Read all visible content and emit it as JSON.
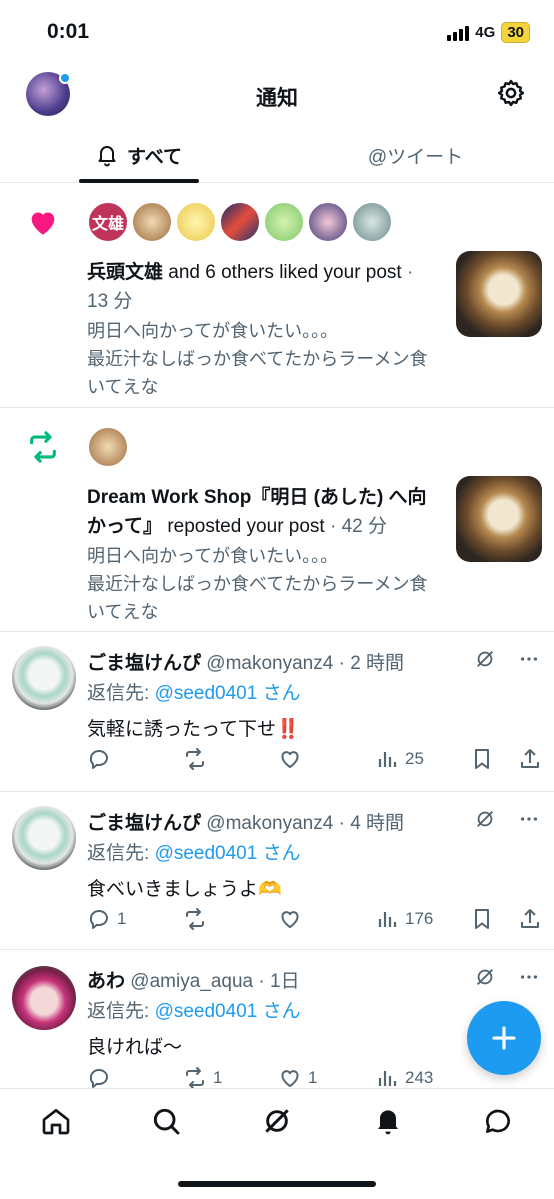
{
  "status_bar": {
    "time": "0:01",
    "network": "4G",
    "battery": "30"
  },
  "header": {
    "title": "通知"
  },
  "tabs": [
    {
      "label": "すべて"
    },
    {
      "label": "@ツイート"
    }
  ],
  "notifications": [
    {
      "type": "like",
      "icon": "heart-icon",
      "first_user": "兵頭文雄",
      "avatar_label": "文雄",
      "action": " and 6 others liked your post",
      "time": " · 13 分",
      "body": "明日へ向かってが食いたい。。。\n最近汁なしばっか食べてたからラーメン食いてえな"
    },
    {
      "type": "repost",
      "icon": "repost-icon",
      "first_user": "Dream Work Shop『明日 (あした) へ向かって』",
      "action": " reposted your post",
      "time": " · 42 分",
      "body": "明日へ向かってが食いたい。。。\n最近汁なしばっか食べてたからラーメン食いてえな"
    }
  ],
  "replies": [
    {
      "name": "ごま塩けんぴ",
      "handle": " @makonyanz4",
      "sep": " · ",
      "time": "2 時間",
      "reply_prefix": "返信先: ",
      "reply_to": "@seed0401 さん",
      "text": "気軽に誘ったって下せ‼️",
      "counts": {
        "reply": "",
        "repost": "",
        "like": "",
        "views": "25"
      }
    },
    {
      "name": "ごま塩けんぴ",
      "handle": " @makonyanz4",
      "sep": " · ",
      "time": "4 時間",
      "reply_prefix": "返信先: ",
      "reply_to": "@seed0401 さん",
      "text": "食べいきましょうよ🫶",
      "counts": {
        "reply": "1",
        "repost": "",
        "like": "",
        "views": "176"
      }
    },
    {
      "name": "あわ",
      "handle": " @amiya_aqua",
      "sep": " · ",
      "time": "1日",
      "reply_prefix": "返信先: ",
      "reply_to": "@seed0401 さん",
      "text": "良ければ〜",
      "counts": {
        "reply": "",
        "repost": "1",
        "like": "1",
        "views": "243"
      }
    }
  ],
  "colors": {
    "accent": "#1d9bf0",
    "like": "#f91880",
    "repost": "#00ba7c",
    "muted": "#536471"
  }
}
